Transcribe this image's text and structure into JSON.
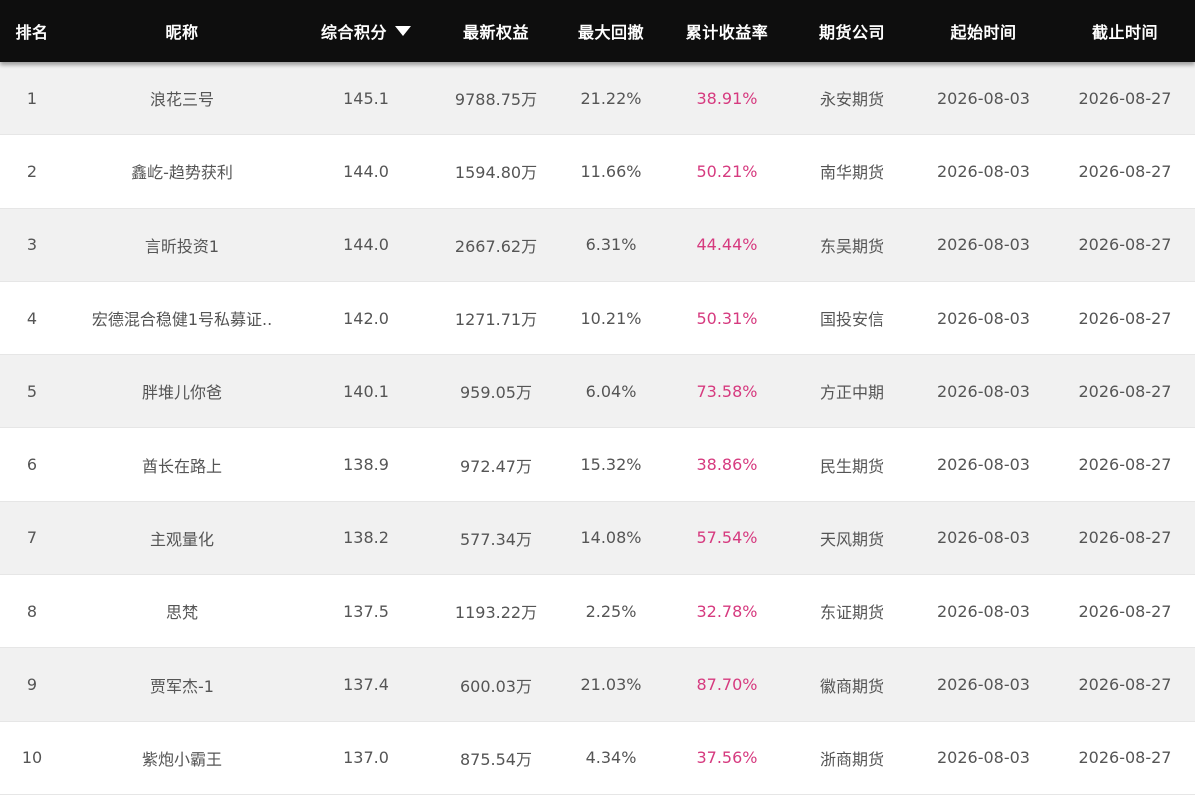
{
  "header": {
    "rank": "排名",
    "nickname": "昵称",
    "score": "综合积分",
    "equity": "最新权益",
    "drawdown": "最大回撤",
    "return": "累计收益率",
    "company": "期货公司",
    "start": "起始时间",
    "end": "截止时间",
    "sort_icon": "caret-down-icon"
  },
  "colors": {
    "header_bg": "#0e0e0e",
    "return_text": "#d63a7f",
    "stripe_bg": "#f1f1f1"
  },
  "rows": [
    {
      "rank": "1",
      "name": "浪花三号",
      "score": "145.1",
      "equity": "9788.75万",
      "drawdown": "21.22%",
      "ret": "38.91%",
      "company": "永安期货",
      "start": "2026-08-03",
      "end": "2026-08-27"
    },
    {
      "rank": "2",
      "name": "鑫屹-趋势获利",
      "score": "144.0",
      "equity": "1594.80万",
      "drawdown": "11.66%",
      "ret": "50.21%",
      "company": "南华期货",
      "start": "2026-08-03",
      "end": "2026-08-27"
    },
    {
      "rank": "3",
      "name": "言昕投资1",
      "score": "144.0",
      "equity": "2667.62万",
      "drawdown": "6.31%",
      "ret": "44.44%",
      "company": "东吴期货",
      "start": "2026-08-03",
      "end": "2026-08-27"
    },
    {
      "rank": "4",
      "name": "宏德混合稳健1号私募证..",
      "score": "142.0",
      "equity": "1271.71万",
      "drawdown": "10.21%",
      "ret": "50.31%",
      "company": "国投安信",
      "start": "2026-08-03",
      "end": "2026-08-27"
    },
    {
      "rank": "5",
      "name": "胖堆儿你爸",
      "score": "140.1",
      "equity": "959.05万",
      "drawdown": "6.04%",
      "ret": "73.58%",
      "company": "方正中期",
      "start": "2026-08-03",
      "end": "2026-08-27"
    },
    {
      "rank": "6",
      "name": "酋长在路上",
      "score": "138.9",
      "equity": "972.47万",
      "drawdown": "15.32%",
      "ret": "38.86%",
      "company": "民生期货",
      "start": "2026-08-03",
      "end": "2026-08-27"
    },
    {
      "rank": "7",
      "name": "主观量化",
      "score": "138.2",
      "equity": "577.34万",
      "drawdown": "14.08%",
      "ret": "57.54%",
      "company": "天风期货",
      "start": "2026-08-03",
      "end": "2026-08-27"
    },
    {
      "rank": "8",
      "name": "思梵",
      "score": "137.5",
      "equity": "1193.22万",
      "drawdown": "2.25%",
      "ret": "32.78%",
      "company": "东证期货",
      "start": "2026-08-03",
      "end": "2026-08-27"
    },
    {
      "rank": "9",
      "name": "贾军杰-1",
      "score": "137.4",
      "equity": "600.03万",
      "drawdown": "21.03%",
      "ret": "87.70%",
      "company": "徽商期货",
      "start": "2026-08-03",
      "end": "2026-08-27"
    },
    {
      "rank": "10",
      "name": "紫炮小霸王",
      "score": "137.0",
      "equity": "875.54万",
      "drawdown": "4.34%",
      "ret": "37.56%",
      "company": "浙商期货",
      "start": "2026-08-03",
      "end": "2026-08-27"
    }
  ]
}
